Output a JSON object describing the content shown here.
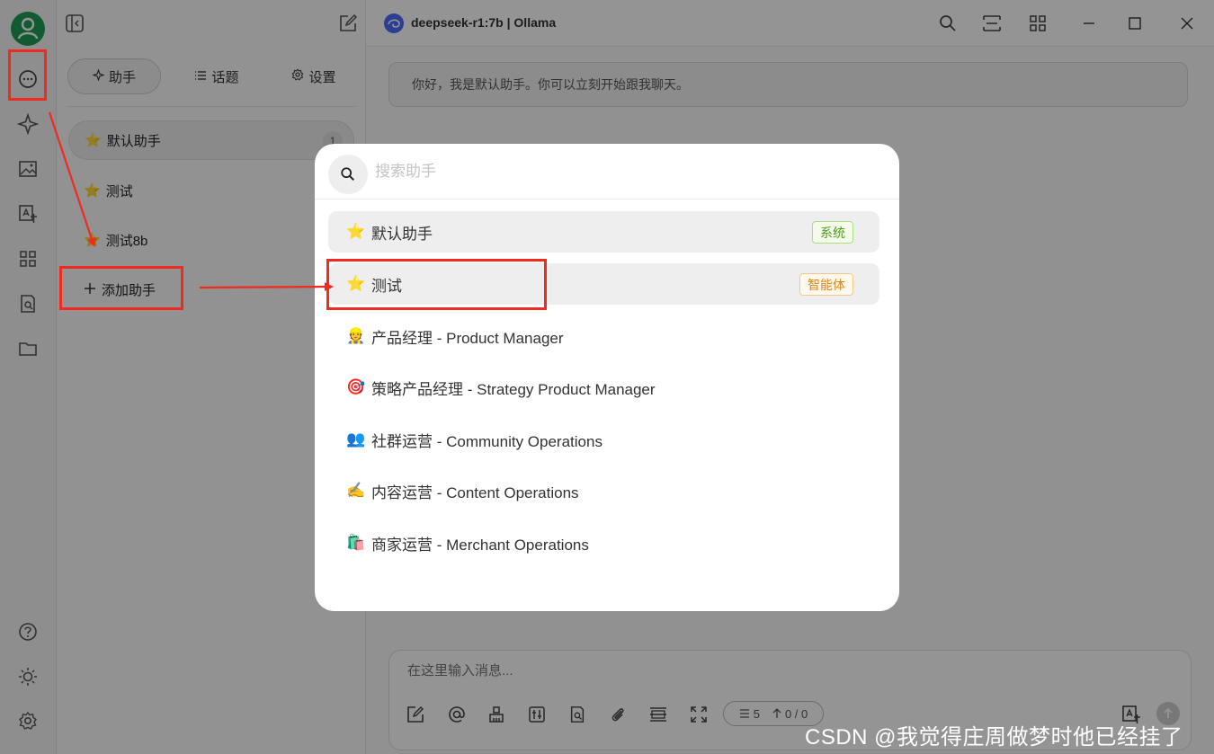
{
  "app": {
    "model_title": "deepseek-r1:7b | Ollama"
  },
  "panel": {
    "tabs": [
      {
        "label": "助手",
        "icon": "sparkle-icon"
      },
      {
        "label": "话题",
        "icon": "list-icon"
      },
      {
        "label": "设置",
        "icon": "gear-icon"
      }
    ],
    "assistants": [
      {
        "label": "默认助手",
        "count": "1"
      },
      {
        "label": "测试"
      },
      {
        "label": "测试8b"
      }
    ],
    "add_label": "添加助手"
  },
  "chat": {
    "welcome": "你好，我是默认助手。你可以立刻开始跟我聊天。",
    "input_placeholder": "在这里输入消息...",
    "counter_left": "5",
    "counter_right": "0 / 0"
  },
  "modal": {
    "search_placeholder": "搜索助手",
    "options": [
      {
        "emoji": "⭐",
        "label": "默认助手",
        "tag": "系统",
        "tag_color": "#4f9e1e"
      },
      {
        "emoji": "⭐",
        "label": "测试",
        "tag": "智能体",
        "tag_color": "#d9861a"
      },
      {
        "emoji": "👷",
        "label": "产品经理 - Product Manager"
      },
      {
        "emoji": "🎯",
        "label": "策略产品经理 - Strategy Product Manager"
      },
      {
        "emoji": "👥",
        "label": "社群运营 - Community Operations"
      },
      {
        "emoji": "✍️",
        "label": "内容运营 - Content Operations"
      },
      {
        "emoji": "🛍️",
        "label": "商家运营 - Merchant Operations"
      }
    ]
  },
  "watermark": "CSDN @我觉得庄周做梦时他已经挂了",
  "colors": {
    "accent_red": "#f12a1e",
    "avatar_green": "#1f9d55",
    "deepseek_blue": "#4d6bfe"
  }
}
